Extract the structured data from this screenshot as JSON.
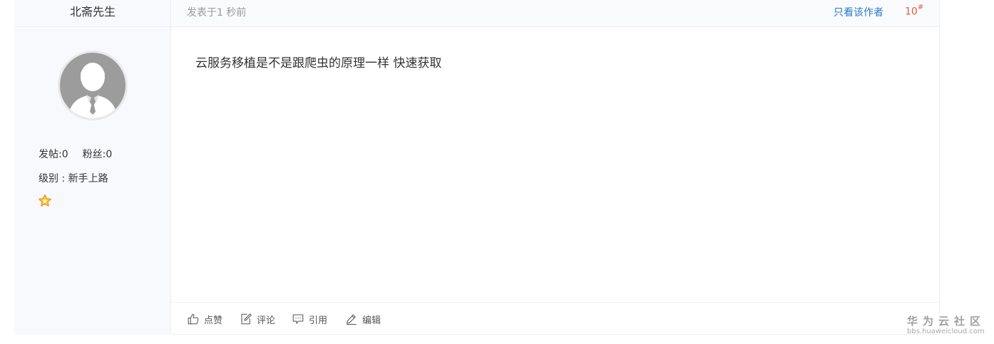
{
  "author": {
    "name": "北斋先生",
    "stats_posts": "发帖:0",
    "stats_fans": "粉丝:0",
    "level": "级别 : 新手上路",
    "avatar_icon": "default-user-avatar",
    "level_icon": "star-icon"
  },
  "post": {
    "time": "发表于1 秒前",
    "only_author": "只看该作者",
    "floor_number": "10",
    "floor_mark": "#",
    "content": "云服务移植是不是跟爬虫的原理一样 快速获取"
  },
  "actions": {
    "like": "点赞",
    "comment": "评论",
    "quote": "引用",
    "edit": "编辑"
  },
  "watermark": {
    "name": "华为云社区",
    "url": "bbs.huaweicloud.com"
  },
  "colors": {
    "link": "#2a7ac8",
    "floor": "#e9593c",
    "sidebar_bg": "#f8f9fd",
    "star": "#f5a623"
  }
}
